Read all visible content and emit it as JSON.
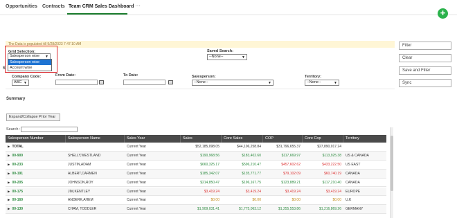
{
  "tabs": [
    {
      "label": "Opportunities"
    },
    {
      "label": "Contracts"
    },
    {
      "label": "Team CRM Sales Dashboard"
    }
  ],
  "more_label": "···",
  "fab_label": "+",
  "notice": "The Data is populated till 9/28/2023 7:47:10 AM",
  "filters": {
    "grid_selection_label": "Grid Selection:",
    "grid_selection_value": "Salesperson wise",
    "grid_options": [
      "Salesperson wise",
      "Account wise"
    ],
    "saved_search_label": "Saved Search:",
    "saved_search_value": "--None--",
    "company_code_label": "Company Code:",
    "company_code_value": "ABC",
    "from_date_label": "From Date:",
    "to_date_label": "To Date:",
    "salesperson_label": "Salesperson:",
    "salesperson_value": "--None--",
    "territory_label": "Territory:",
    "territory_value": "--None--",
    "s_fragment": "S"
  },
  "side_buttons": [
    "Filter",
    "Clear",
    "Save and Filter",
    "Sync"
  ],
  "summary_label": "Summary",
  "expand_label": "Expand/Collapse Prior Year",
  "search_label": "Search :",
  "table": {
    "headers": [
      "Salesperson Number",
      "Salesperson Name",
      "Sales Year",
      "Sales",
      "Core Sales",
      "COP",
      "Core Cop",
      "Territory"
    ],
    "rows": [
      {
        "id": "TOTAL",
        "name": "",
        "year": "Current Year",
        "sales": "$52,185,098.05",
        "core_sales": "$44,106,258.84",
        "cop": "$31,796,655.37",
        "core_cop": "$27,890,017.24",
        "territory": ""
      },
      {
        "id": "00-900",
        "name": "SHELLY,WESTLAND",
        "year": "Current Year",
        "sales": "$190,968.56",
        "core_sales": "$183,402.60",
        "cop": "$117,669.97",
        "core_cop": "$113,925.38",
        "territory": "US & CANADA"
      },
      {
        "id": "00-233",
        "name": "JUSTIN,ADAM",
        "year": "Current Year",
        "sales": "$660,325.17",
        "core_sales": "$596,210.47",
        "cop": "$457,602.62",
        "core_cop": "$433,222.50",
        "territory": "US EAST"
      },
      {
        "id": "00-191",
        "name": "ALBERT,CARMEN",
        "year": "Current Year",
        "sales": "$185,342.07",
        "core_sales": "$135,771.77",
        "cop": "$79,102.09",
        "core_cop": "$60,740.19",
        "territory": "CANADA"
      },
      {
        "id": "00-205",
        "name": "JOHNSON,ROY",
        "year": "Current Year",
        "sales": "$214,850.47",
        "core_sales": "$196,167.75",
        "cop": "$123,889.21",
        "core_cop": "$117,210.40",
        "territory": "CANADA"
      },
      {
        "id": "00-175",
        "name": "JIM,KENTLEY",
        "year": "Current Year",
        "sales": "$3,419.24",
        "core_sales": "$3,419.24",
        "cop": "$3,419.24",
        "core_cop": "$3,419.24",
        "territory": "EUROPE"
      },
      {
        "id": "00-160",
        "name": "ANDERK,AHEM",
        "year": "Current Year",
        "sales": "$0.00",
        "core_sales": "$0.00",
        "cop": "$0.00",
        "core_cop": "$0.00",
        "territory": "U.K"
      },
      {
        "id": "00-130",
        "name": "CHAM, TODDLER",
        "year": "Current Year",
        "sales": "$1,909,031.41",
        "core_sales": "$1,775,063.12",
        "cop": "$1,255,553.86",
        "core_cop": "$1,216,869.26",
        "territory": "GERMANY"
      }
    ]
  },
  "colors": {
    "accent_green": "#1b7d2e",
    "fab_green": "#2bb24c",
    "highlight_red": "#d9262c",
    "header_dark": "#4a4a4a",
    "value_green": "#2b8a3e",
    "value_red": "#dd3333",
    "value_amber": "#c38b1a"
  }
}
